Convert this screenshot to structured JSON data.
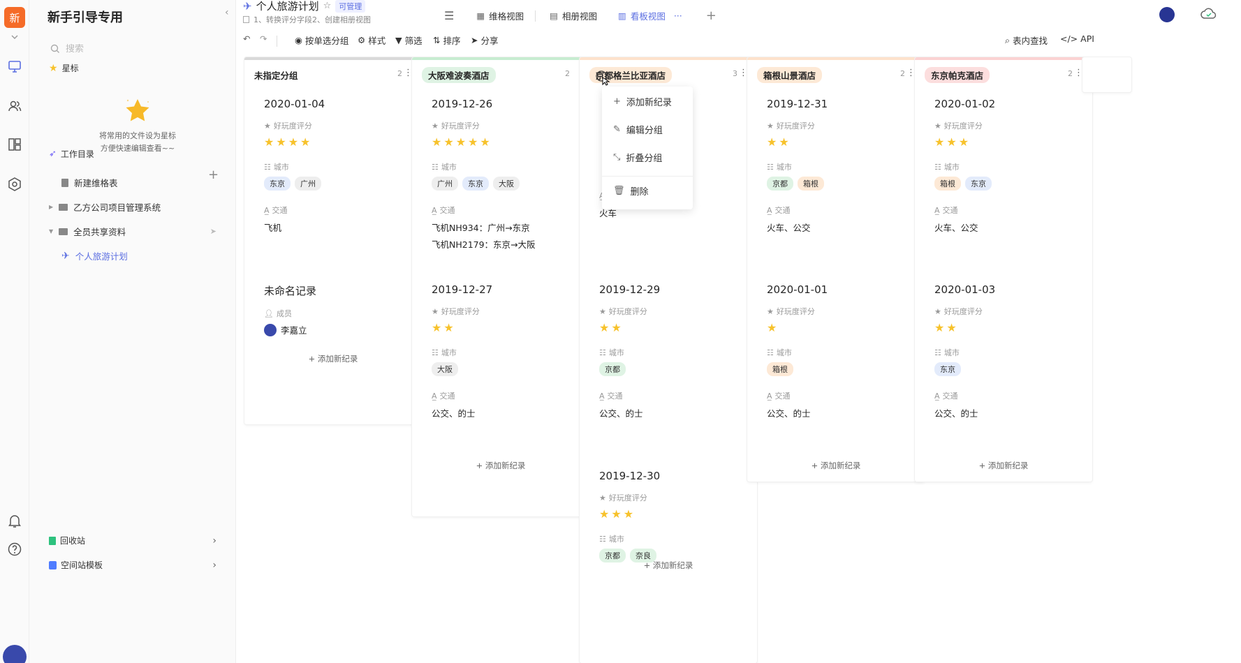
{
  "workspace": {
    "logo_char": "新",
    "name": "新手引导专用"
  },
  "sidebar": {
    "search_placeholder": "搜索",
    "starred_label": "星标",
    "starred_empty_line1": "将常用的文件设为星标",
    "starred_empty_line2": "方便快速编辑查看~~",
    "work_dir_label": "工作目录",
    "tree": [
      {
        "label": "新建维格表"
      },
      {
        "label": "乙方公司项目管理系统"
      },
      {
        "label": "全员共享资料"
      },
      {
        "label": "个人旅游计划"
      }
    ],
    "recycle_label": "回收站",
    "template_label": "空间站模板"
  },
  "header": {
    "doc_title": "个人旅游计划",
    "permission_badge": "可管理",
    "doc_desc": "1、转换评分字段2、创建相册视图",
    "views": [
      {
        "label": "维格视图"
      },
      {
        "label": "相册视图"
      },
      {
        "label": "看板视图"
      }
    ],
    "more": "···",
    "add": "+"
  },
  "toolbar": {
    "group_by": "按单选分组",
    "style": "样式",
    "filter": "筛选",
    "sort": "排序",
    "share": "分享",
    "find": "表内查找",
    "api": "API"
  },
  "colors": {
    "accent": "#5b6ee1",
    "star": "#f7c22c",
    "tag_blue": "#e3ebfb",
    "tag_grey": "#eeeeee",
    "tag_green": "#dff3e4",
    "tag_orange": "#fde9d6"
  },
  "field_labels": {
    "rating": "好玩度评分",
    "city": "城市",
    "transport": "交通",
    "member": "成员"
  },
  "board": {
    "add_record": "添加新纪录",
    "columns": [
      {
        "name": "未指定分组",
        "count": "2",
        "cards": [
          {
            "title": "2020-01-04",
            "rating": 4,
            "cities": [
              "东京",
              "广州"
            ],
            "transport": [
              "飞机"
            ]
          },
          {
            "title": "未命名记录",
            "member": "李嘉立"
          }
        ]
      },
      {
        "name": "大阪难波奏酒店",
        "count": "2",
        "cards": [
          {
            "title": "2019-12-26",
            "rating": 5,
            "cities": [
              "广州",
              "东京",
              "大阪"
            ],
            "transport": [
              "飞机NH934：广州→东京",
              "飞机NH2179：东京→大阪"
            ]
          },
          {
            "title": "2019-12-27",
            "rating": 2,
            "cities": [
              "大阪"
            ],
            "transport": [
              "公交、的士"
            ]
          }
        ]
      },
      {
        "name": "京都格兰比亚酒店",
        "count": "3",
        "cards": [
          {
            "title": "",
            "transport": [
              "火车"
            ]
          },
          {
            "title": "2019-12-29",
            "rating": 2,
            "cities": [
              "京都"
            ],
            "transport": [
              "公交、的士"
            ]
          },
          {
            "title": "2019-12-30",
            "rating": 3,
            "cities": [
              "京都",
              "奈良"
            ]
          }
        ]
      },
      {
        "name": "箱根山景酒店",
        "count": "2",
        "cards": [
          {
            "title": "2019-12-31",
            "rating": 2,
            "cities": [
              "京都",
              "箱根"
            ],
            "transport": [
              "火车、公交"
            ]
          },
          {
            "title": "2020-01-01",
            "rating": 1,
            "cities": [
              "箱根"
            ],
            "transport": [
              "公交、的士"
            ]
          }
        ]
      },
      {
        "name": "东京帕克酒店",
        "count": "2",
        "cards": [
          {
            "title": "2020-01-02",
            "rating": 3,
            "cities": [
              "箱根",
              "东京"
            ],
            "transport": [
              "火车、公交"
            ]
          },
          {
            "title": "2020-01-03",
            "rating": 2,
            "cities": [
              "东京"
            ],
            "transport": [
              "公交、的士"
            ]
          }
        ]
      }
    ]
  },
  "context_menu": {
    "add_record": "添加新纪录",
    "edit_group": "编辑分组",
    "collapse_group": "折叠分组",
    "delete": "删除"
  }
}
